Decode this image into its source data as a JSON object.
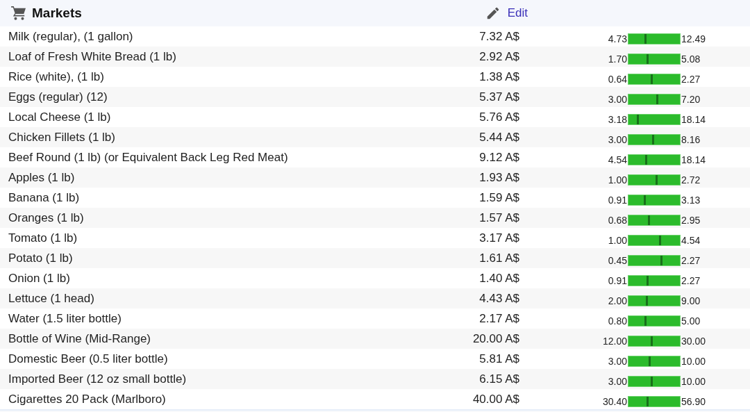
{
  "header": {
    "title": "Markets",
    "edit_link": "Edit"
  },
  "rows": [
    {
      "name": "Milk (regular), (1 gallon)",
      "price": "7.32 A$",
      "min": "4.73",
      "max": "12.49",
      "level": 0.33
    },
    {
      "name": "Loaf of Fresh White Bread (1 lb)",
      "price": "2.92 A$",
      "min": "1.70",
      "max": "5.08",
      "level": 0.36
    },
    {
      "name": "Rice (white), (1 lb)",
      "price": "1.38 A$",
      "min": "0.64",
      "max": "2.27",
      "level": 0.45
    },
    {
      "name": "Eggs (regular) (12)",
      "price": "5.37 A$",
      "min": "3.00",
      "max": "7.20",
      "level": 0.56
    },
    {
      "name": "Local Cheese (1 lb)",
      "price": "5.76 A$",
      "min": "3.18",
      "max": "18.14",
      "level": 0.17
    },
    {
      "name": "Chicken Fillets (1 lb)",
      "price": "5.44 A$",
      "min": "3.00",
      "max": "8.16",
      "level": 0.47
    },
    {
      "name": "Beef Round (1 lb) (or Equivalent Back Leg Red Meat)",
      "price": "9.12 A$",
      "min": "4.54",
      "max": "18.14",
      "level": 0.34
    },
    {
      "name": "Apples (1 lb)",
      "price": "1.93 A$",
      "min": "1.00",
      "max": "2.72",
      "level": 0.54
    },
    {
      "name": "Banana (1 lb)",
      "price": "1.59 A$",
      "min": "0.91",
      "max": "3.13",
      "level": 0.31
    },
    {
      "name": "Oranges (1 lb)",
      "price": "1.57 A$",
      "min": "0.68",
      "max": "2.95",
      "level": 0.39
    },
    {
      "name": "Tomato (1 lb)",
      "price": "3.17 A$",
      "min": "1.00",
      "max": "4.54",
      "level": 0.61
    },
    {
      "name": "Potato (1 lb)",
      "price": "1.61 A$",
      "min": "0.45",
      "max": "2.27",
      "level": 0.64
    },
    {
      "name": "Onion (1 lb)",
      "price": "1.40 A$",
      "min": "0.91",
      "max": "2.27",
      "level": 0.36
    },
    {
      "name": "Lettuce (1 head)",
      "price": "4.43 A$",
      "min": "2.00",
      "max": "9.00",
      "level": 0.35
    },
    {
      "name": "Water (1.5 liter bottle)",
      "price": "2.17 A$",
      "min": "0.80",
      "max": "5.00",
      "level": 0.33
    },
    {
      "name": "Bottle of Wine (Mid-Range)",
      "price": "20.00 A$",
      "min": "12.00",
      "max": "30.00",
      "level": 0.44
    },
    {
      "name": "Domestic Beer (0.5 liter bottle)",
      "price": "5.81 A$",
      "min": "3.00",
      "max": "10.00",
      "level": 0.4
    },
    {
      "name": "Imported Beer (12 oz small bottle)",
      "price": "6.15 A$",
      "min": "3.00",
      "max": "10.00",
      "level": 0.45
    },
    {
      "name": "Cigarettes 20 Pack (Marlboro)",
      "price": "40.00 A$",
      "min": "30.40",
      "max": "56.90",
      "level": 0.36
    }
  ]
}
